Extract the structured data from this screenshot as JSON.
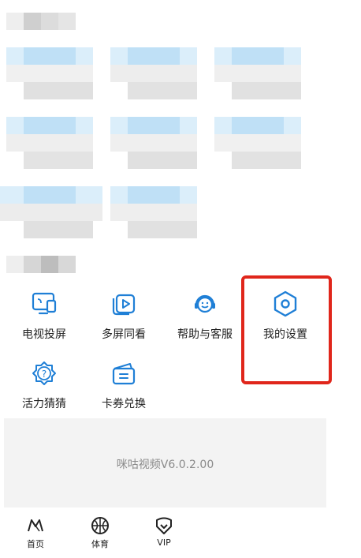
{
  "tools": [
    {
      "label": "电视投屏"
    },
    {
      "label": "多屏同看"
    },
    {
      "label": "帮助与客服"
    },
    {
      "label": "我的设置"
    },
    {
      "label": "活力猜猜"
    },
    {
      "label": "卡券兑换"
    }
  ],
  "version": "咪咕视频V6.0.2.00",
  "tabs": [
    {
      "label": "首页"
    },
    {
      "label": "体育"
    },
    {
      "label": "VIP"
    }
  ],
  "colors": {
    "icon_blue": "#1f7fd6",
    "highlight_red": "#e0261b",
    "version_bg": "#f3f3f3"
  }
}
